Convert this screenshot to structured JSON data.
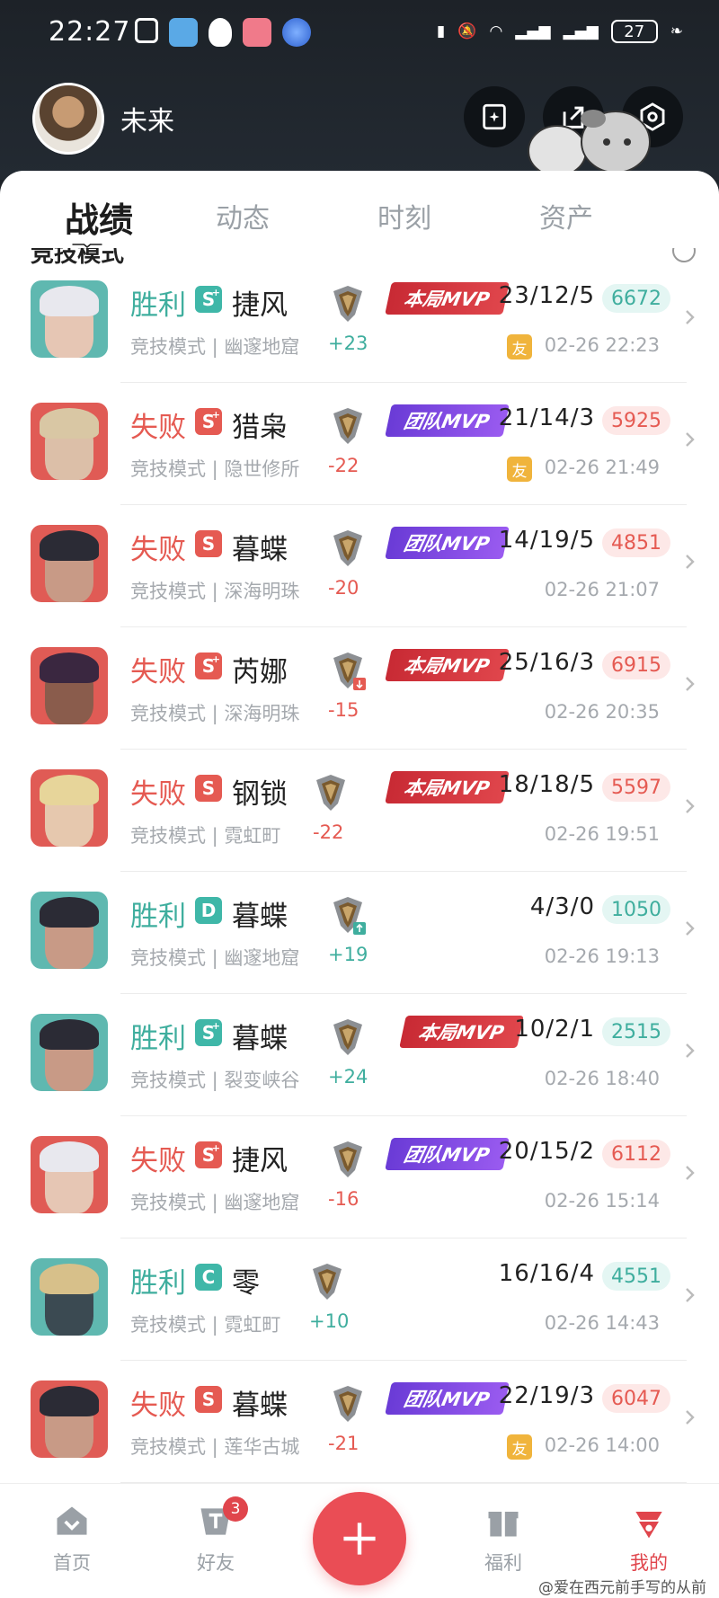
{
  "status_bar": {
    "time": "22:27",
    "battery": "27"
  },
  "profile": {
    "nickname": "未来"
  },
  "tabs": [
    {
      "label": "战绩",
      "active": true
    },
    {
      "label": "动态",
      "active": false
    },
    {
      "label": "时刻",
      "active": false
    },
    {
      "label": "资产",
      "active": false
    }
  ],
  "section": {
    "title": "竞技模式"
  },
  "matches": [
    {
      "result": "胜利",
      "outcome": "win",
      "grade": "S",
      "plus": true,
      "grade_color": "#3fb7a8",
      "agent": "捷风",
      "mode_map": "竞技模式 | 幽邃地窟",
      "delta": "+23",
      "mvp": "本局MVP",
      "mvp_type": "match",
      "kda": "23/12/5",
      "score": "6672",
      "friend": "友",
      "datetime": "02-26 22:23",
      "hero_bg": "#5fb8b0",
      "hero_hair": "#e8e8ee",
      "hero_face": "#e6c6b4",
      "rank_arrow": ""
    },
    {
      "result": "失败",
      "outcome": "loss",
      "grade": "S",
      "plus": true,
      "grade_color": "#e55a52",
      "agent": "猎枭",
      "mode_map": "竞技模式 | 隐世修所",
      "delta": "-22",
      "mvp": "团队MVP",
      "mvp_type": "team",
      "kda": "21/14/3",
      "score": "5925",
      "friend": "友",
      "datetime": "02-26 21:49",
      "hero_bg": "#e05b55",
      "hero_hair": "#d9c7a4",
      "hero_face": "#dcbfa8",
      "rank_arrow": ""
    },
    {
      "result": "失败",
      "outcome": "loss",
      "grade": "S",
      "plus": false,
      "grade_color": "#e55a52",
      "agent": "暮蝶",
      "mode_map": "竞技模式 | 深海明珠",
      "delta": "-20",
      "mvp": "团队MVP",
      "mvp_type": "team",
      "kda": "14/19/5",
      "score": "4851",
      "friend": "",
      "datetime": "02-26 21:07",
      "hero_bg": "#e05b55",
      "hero_hair": "#2b2b35",
      "hero_face": "#c89a86",
      "rank_arrow": ""
    },
    {
      "result": "失败",
      "outcome": "loss",
      "grade": "S",
      "plus": true,
      "grade_color": "#e55a52",
      "agent": "芮娜",
      "mode_map": "竞技模式 | 深海明珠",
      "delta": "-15",
      "mvp": "本局MVP",
      "mvp_type": "match",
      "kda": "25/16/3",
      "score": "6915",
      "friend": "",
      "datetime": "02-26 20:35",
      "hero_bg": "#e05b55",
      "hero_hair": "#3a2740",
      "hero_face": "#8a5c4c",
      "rank_arrow": "down"
    },
    {
      "result": "失败",
      "outcome": "loss",
      "grade": "S",
      "plus": false,
      "grade_color": "#e55a52",
      "agent": "钢锁",
      "mode_map": "竞技模式 | 霓虹町",
      "delta": "-22",
      "mvp": "本局MVP",
      "mvp_type": "match",
      "kda": "18/18/5",
      "score": "5597",
      "friend": "",
      "datetime": "02-26 19:51",
      "hero_bg": "#e05b55",
      "hero_hair": "#e7d59a",
      "hero_face": "#e6c8ae",
      "rank_arrow": ""
    },
    {
      "result": "胜利",
      "outcome": "win",
      "grade": "D",
      "plus": false,
      "grade_color": "#3fb7a8",
      "agent": "暮蝶",
      "mode_map": "竞技模式 | 幽邃地窟",
      "delta": "+19",
      "mvp": "",
      "mvp_type": "",
      "kda": "4/3/0",
      "score": "1050",
      "friend": "",
      "datetime": "02-26 19:13",
      "hero_bg": "#5fb8b0",
      "hero_hair": "#2b2b35",
      "hero_face": "#c89a86",
      "rank_arrow": "up"
    },
    {
      "result": "胜利",
      "outcome": "win",
      "grade": "S",
      "plus": true,
      "grade_color": "#3fb7a8",
      "agent": "暮蝶",
      "mode_map": "竞技模式 | 裂变峡谷",
      "delta": "+24",
      "mvp": "本局MVP",
      "mvp_type": "match",
      "kda": "10/2/1",
      "score": "2515",
      "friend": "",
      "datetime": "02-26 18:40",
      "hero_bg": "#5fb8b0",
      "hero_hair": "#2b2b35",
      "hero_face": "#c89a86",
      "rank_arrow": ""
    },
    {
      "result": "失败",
      "outcome": "loss",
      "grade": "S",
      "plus": true,
      "grade_color": "#e55a52",
      "agent": "捷风",
      "mode_map": "竞技模式 | 幽邃地窟",
      "delta": "-16",
      "mvp": "团队MVP",
      "mvp_type": "team",
      "kda": "20/15/2",
      "score": "6112",
      "friend": "",
      "datetime": "02-26 15:14",
      "hero_bg": "#e05b55",
      "hero_hair": "#e8e8ee",
      "hero_face": "#e6c6b4",
      "rank_arrow": ""
    },
    {
      "result": "胜利",
      "outcome": "win",
      "grade": "C",
      "plus": false,
      "grade_color": "#3fb7a8",
      "agent": "零",
      "mode_map": "竞技模式 | 霓虹町",
      "delta": "+10",
      "mvp": "",
      "mvp_type": "",
      "kda": "16/16/4",
      "score": "4551",
      "friend": "",
      "datetime": "02-26 14:43",
      "hero_bg": "#5fb8b0",
      "hero_hair": "#d7c08a",
      "hero_face": "#3b4a52",
      "rank_arrow": ""
    },
    {
      "result": "失败",
      "outcome": "loss",
      "grade": "S",
      "plus": false,
      "grade_color": "#e55a52",
      "agent": "暮蝶",
      "mode_map": "竞技模式 | 莲华古城",
      "delta": "-21",
      "mvp": "团队MVP",
      "mvp_type": "team",
      "kda": "22/19/3",
      "score": "6047",
      "friend": "友",
      "datetime": "02-26 14:00",
      "hero_bg": "#e05b55",
      "hero_hair": "#2b2b35",
      "hero_face": "#c89a86",
      "rank_arrow": ""
    }
  ],
  "bottom_nav": [
    {
      "label": "首页",
      "icon": "home-icon",
      "active": false
    },
    {
      "label": "好友",
      "icon": "friends-icon",
      "active": false,
      "badge": "3"
    },
    {
      "label": "福利",
      "icon": "gift-icon",
      "active": false
    },
    {
      "label": "我的",
      "icon": "profile-icon",
      "active": true
    }
  ],
  "watermark": "@爱在西元前手写的从前"
}
